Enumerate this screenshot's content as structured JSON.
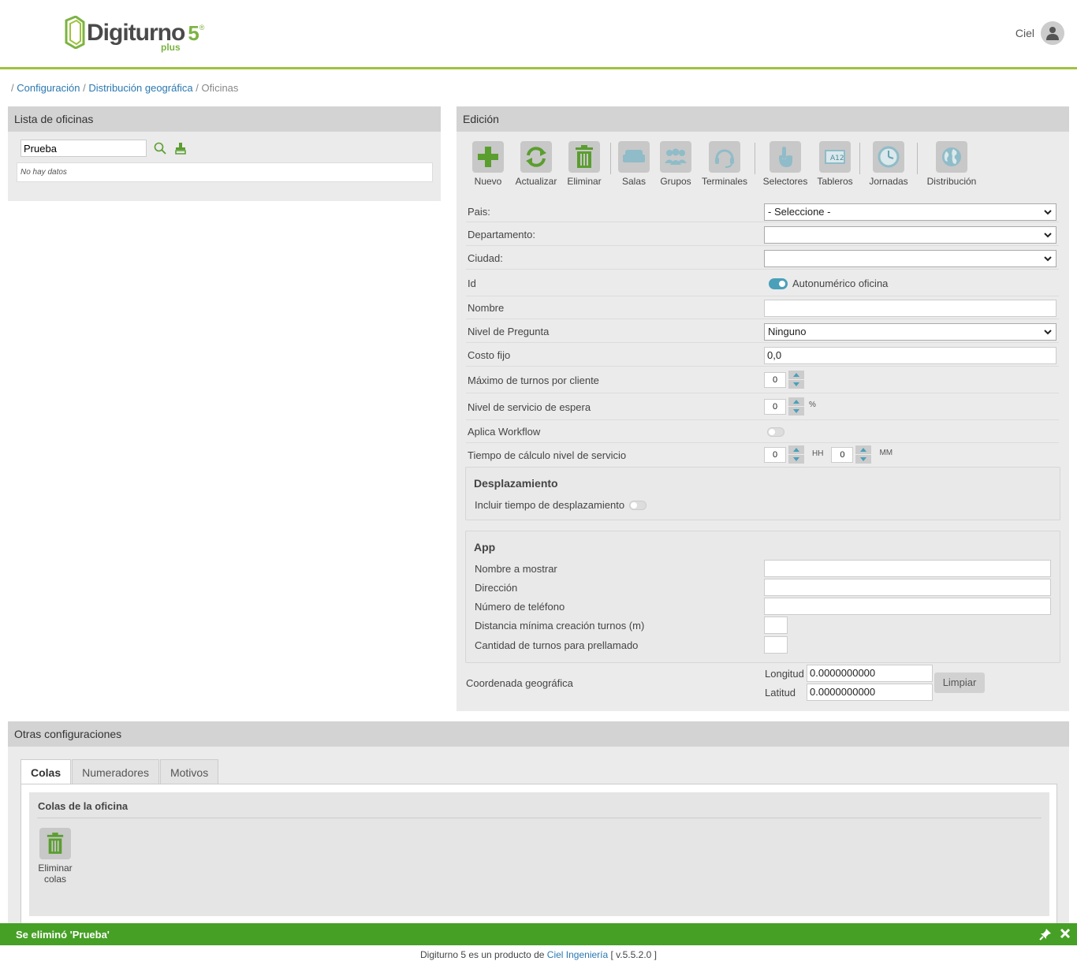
{
  "brand": {
    "name": "Digiturno",
    "version_mark": "5",
    "suffix": "plus",
    "reg": "®",
    "accent": "#7cb342",
    "header_line": "#9fc33c"
  },
  "user": {
    "name": "Ciel"
  },
  "breadcrumb": {
    "sep1": "/",
    "item1": "Configuración",
    "sep2": "/",
    "item2": "Distribución geográfica",
    "sep3": "/",
    "current": "Oficinas"
  },
  "left_panel": {
    "title": "Lista de oficinas",
    "search_value": "Prueba",
    "empty_text": "No hay datos"
  },
  "edit_panel": {
    "title": "Edición",
    "toolbar": {
      "nuevo": "Nuevo",
      "actualizar": "Actualizar",
      "eliminar": "Eliminar",
      "salas": "Salas",
      "grupos": "Grupos",
      "terminales": "Terminales",
      "selectores": "Selectores",
      "tableros": "Tableros",
      "jornadas": "Jornadas",
      "distribucion": "Distribución"
    },
    "form": {
      "pais_label": "Pais:",
      "pais_value": "- Seleccione -",
      "departamento_label": "Departamento:",
      "departamento_value": "",
      "ciudad_label": "Ciudad:",
      "ciudad_value": "",
      "id_label": "Id",
      "id_toggle_label": "Autonumérico oficina",
      "id_toggle_on": true,
      "nombre_label": "Nombre",
      "nombre_value": "",
      "nivel_label": "Nivel de Pregunta",
      "nivel_value": "Ninguno",
      "costo_label": "Costo fijo",
      "costo_value": "0,0",
      "max_turnos_label": "Máximo de turnos por cliente",
      "max_turnos_value": "0",
      "nivel_servicio_label": "Nivel de servicio de espera",
      "nivel_servicio_value": "0",
      "nivel_servicio_unit": "%",
      "workflow_label": "Aplica Workflow",
      "workflow_on": false,
      "tiempo_label": "Tiempo de cálculo nivel de servicio",
      "tiempo_hh": "0",
      "hh_unit": "HH",
      "tiempo_mm": "0",
      "mm_unit": "MM"
    },
    "desplazamiento": {
      "title": "Desplazamiento",
      "incluir_label": "Incluir tiempo de desplazamiento",
      "incluir_on": false
    },
    "app": {
      "title": "App",
      "nombre_mostrar": "Nombre a mostrar",
      "direccion": "Dirección",
      "telefono": "Número de teléfono",
      "distancia": "Distancia mínima creación turnos (m)",
      "prellamado": "Cantidad de turnos para prellamado"
    },
    "coord": {
      "label": "Coordenada geográfica",
      "longitud_label": "Longitud",
      "longitud_value": "0.0000000000",
      "latitud_label": "Latitud",
      "latitud_value": "0.0000000000",
      "limpiar": "Limpiar"
    }
  },
  "otras": {
    "title": "Otras configuraciones",
    "tabs": [
      "Colas",
      "Numeradores",
      "Motivos"
    ],
    "colas_title": "Colas de la oficina",
    "eliminar_colas": "Eliminar colas"
  },
  "notification": {
    "text": "Se eliminó 'Prueba'",
    "color": "#46a025"
  },
  "footer": {
    "prefix": "Digiturno 5 es un producto de",
    "link": "Ciel Ingeniería",
    "version": "[ v.5.5.2.0 ]"
  }
}
